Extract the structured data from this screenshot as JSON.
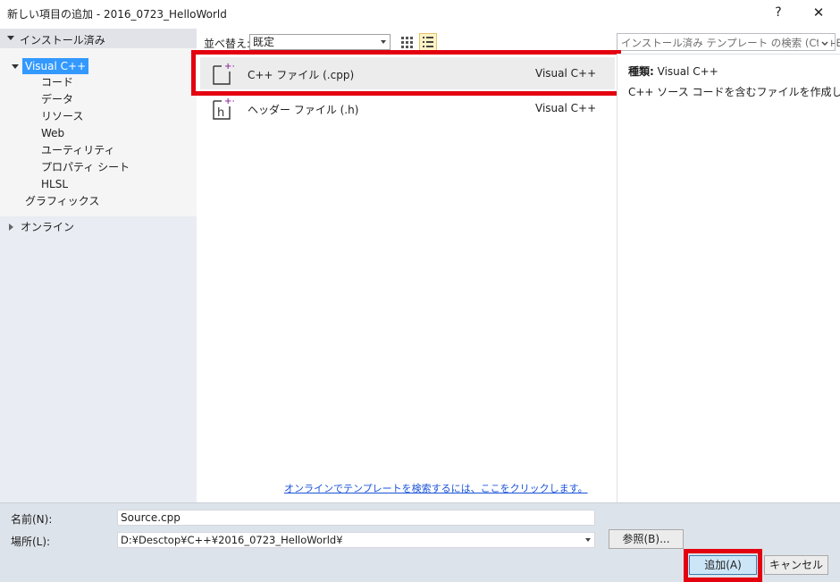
{
  "window": {
    "title": "新しい項目の追加 - 2016_0723_HelloWorld",
    "help_label": "?",
    "close_label": "✕"
  },
  "sidebar": {
    "installed_label": "インストール済み",
    "visual_cpp_label": "Visual C++",
    "children": [
      "コード",
      "データ",
      "リソース",
      "Web",
      "ユーティリティ",
      "プロパティ シート",
      "HLSL"
    ],
    "graphics_label": "グラフィックス",
    "online_label": "オンライン"
  },
  "toolbar": {
    "sort_label": "並べ替え:",
    "sort_value": "既定"
  },
  "templates": [
    {
      "name": "C++ ファイル (.cpp)",
      "type": "Visual C++",
      "icon": "cpp-file-icon",
      "selected": true
    },
    {
      "name": "ヘッダー ファイル (.h)",
      "type": "Visual C++",
      "icon": "header-file-icon",
      "selected": false
    }
  ],
  "online_link": "オンラインでテンプレートを検索するには、ここをクリックします。",
  "search": {
    "placeholder": "インストール済み テンプレート の検索 (Ctrl+E)"
  },
  "details": {
    "kind_label": "種類:",
    "kind_value": "Visual C++",
    "description": "C++ ソース コードを含むファイルを作成します。"
  },
  "form": {
    "name_label": "名前(N):",
    "name_value": "Source.cpp",
    "location_label": "場所(L):",
    "location_value": "D:¥Desctop¥C++¥2016_0723_HelloWorld¥",
    "browse_label": "参照(B)...",
    "add_label": "追加(A)",
    "cancel_label": "キャンセル"
  },
  "colors": {
    "highlight": "#e3000f",
    "selection": "#3399ff",
    "link": "#1a53d8"
  }
}
